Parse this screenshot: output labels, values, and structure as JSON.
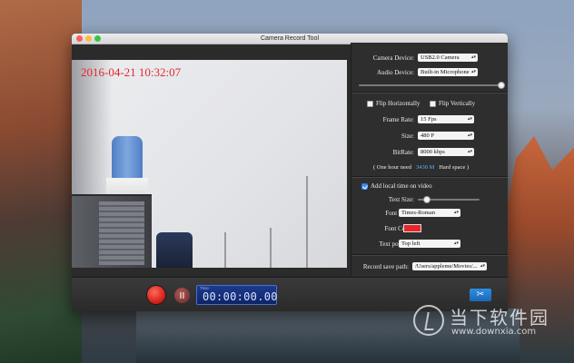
{
  "window": {
    "title": "Camera Record Tool"
  },
  "preview": {
    "timestamp": "2016-04-21 10:32:07"
  },
  "settings": {
    "camera_device": {
      "label": "Camera Device:",
      "value": "USB2.0 Camera"
    },
    "audio_device": {
      "label": "Audio Device:",
      "value": "Built-in Microphone"
    },
    "audio_level": 1.0,
    "flip_horizontally": {
      "label": "Flip Horizontally",
      "checked": false
    },
    "flip_vertically": {
      "label": "Flip Vertically",
      "checked": false
    },
    "frame_rate": {
      "label": "Frame Rate:",
      "value": "15 Fps"
    },
    "size": {
      "label": "Size:",
      "value": "480 P"
    },
    "bitrate": {
      "label": "BitRate:",
      "value": "8000 kbps"
    },
    "hour_info": {
      "prefix": "( One hour need",
      "value": "3430 M",
      "suffix": "Hard space )"
    },
    "add_time": {
      "label": "Add local time on video",
      "checked": true
    },
    "text_size": {
      "label": "Text Size:",
      "level": 0.15
    },
    "font_name": {
      "label": "Font name:",
      "value": "Times-Roman"
    },
    "font_color": {
      "label": "Font Color:",
      "color": "#e8262a"
    },
    "text_position": {
      "label": "Text position:",
      "value": "Top left"
    },
    "save_path": {
      "label": "Record save path:",
      "value": "/Users/appleme/Movies/..."
    }
  },
  "controls": {
    "timer_label": "Time",
    "timer_value": "00:00:00.00",
    "scissors_glyph": "✂"
  },
  "watermark": {
    "cn": "当下软件园",
    "url": "www.downxia.com"
  }
}
